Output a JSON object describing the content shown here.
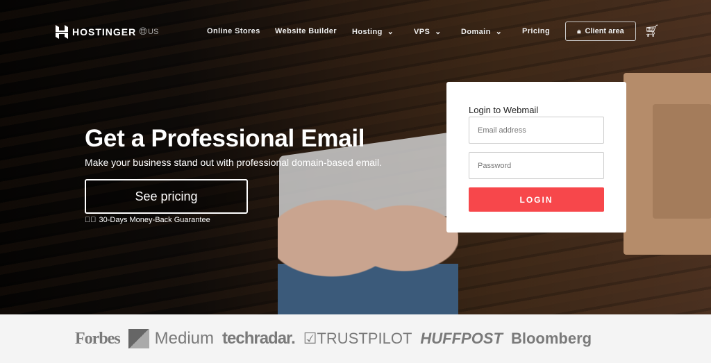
{
  "nav": {
    "brand": "HOSTINGER",
    "locale": "US",
    "items": [
      {
        "label": "Online Stores"
      },
      {
        "label": "Website Builder"
      },
      {
        "label": "Hosting"
      },
      {
        "label": "VPS"
      },
      {
        "label": "Domain"
      },
      {
        "label": "Pricing"
      }
    ],
    "client_area": "Client area"
  },
  "hero": {
    "title": "Get a Professional Email",
    "subtitle": "Make your business stand out with professional domain-based email.",
    "cta": "See pricing",
    "guarantee": "30-Days Money-Back Guarantee"
  },
  "login": {
    "title": "Login to Webmail",
    "email_placeholder": "Email address",
    "password_placeholder": "Password",
    "button": "LOGIN",
    "button_color": "#f7474b"
  },
  "press": [
    "Forbes",
    "Medium",
    "techradar.",
    "TRUSTPILOT",
    "HUFFPOST",
    "Bloomberg"
  ]
}
